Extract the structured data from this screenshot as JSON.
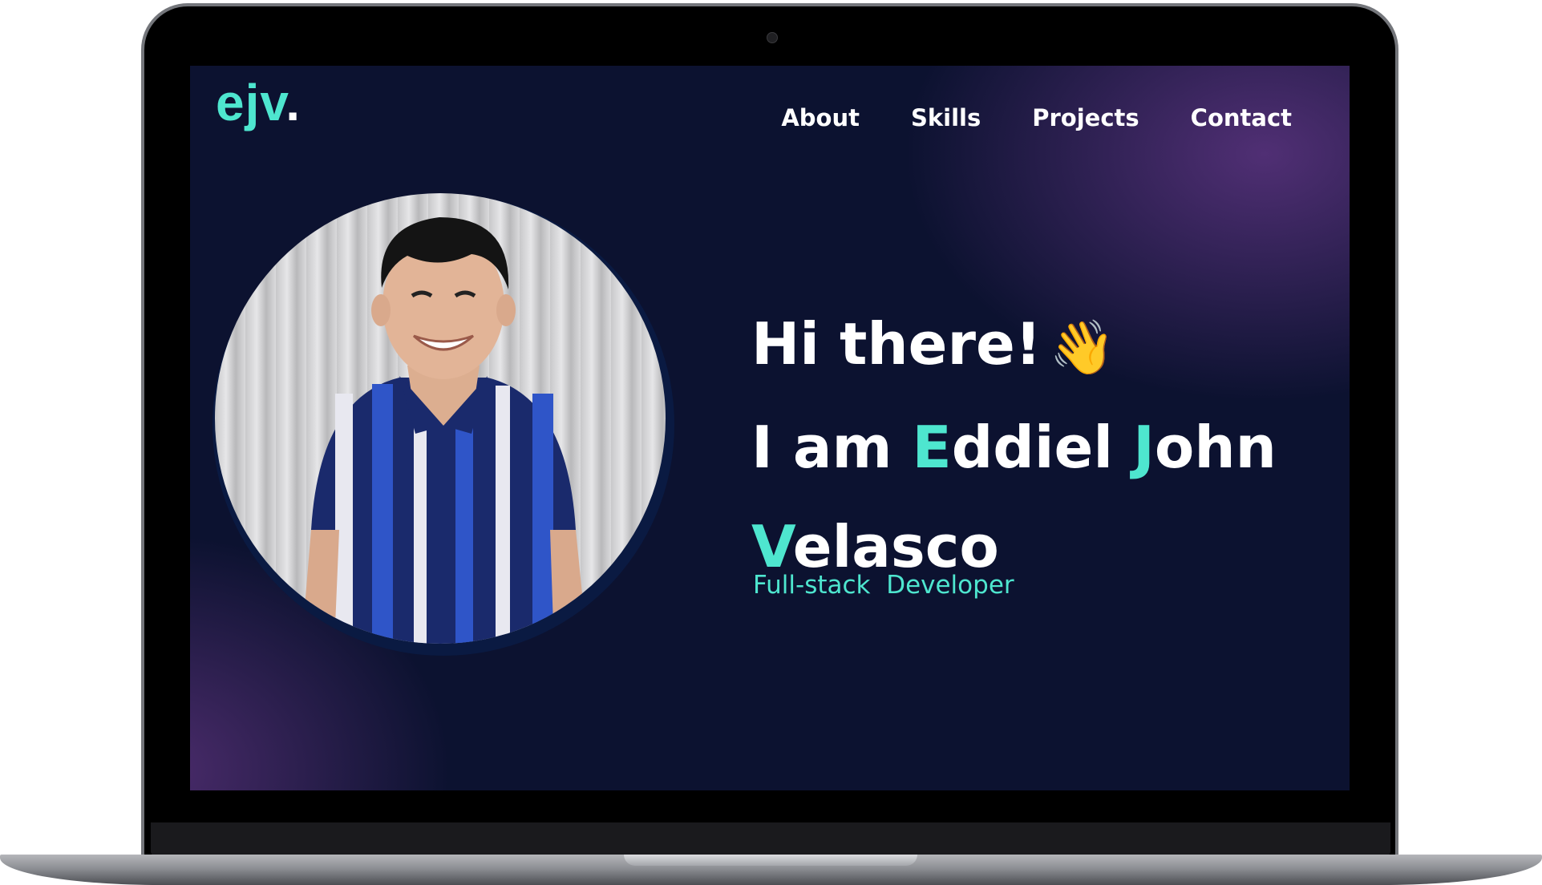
{
  "header": {
    "logo_letters": "ejv",
    "logo_dot": "."
  },
  "nav": {
    "items": [
      {
        "label": "About"
      },
      {
        "label": "Skills"
      },
      {
        "label": "Projects"
      },
      {
        "label": "Contact"
      }
    ]
  },
  "hero": {
    "greeting": "Hi there!",
    "greeting_emoji": "👋",
    "intro": "I am",
    "first_name_initial": "E",
    "first_name_rest": "ddiel",
    "middle_name_initial": "J",
    "middle_name_rest": "ohn",
    "last_name_initial": "V",
    "last_name_rest": "elasco",
    "role": "Full-stack  Developer"
  },
  "colors": {
    "accent": "#4ee6cf",
    "background": "#0c1230",
    "glow": "#5c3480",
    "text": "#ffffff"
  },
  "icons": {
    "greeting_icon": "waving-hand-icon",
    "camera": "camera-dot-icon"
  }
}
